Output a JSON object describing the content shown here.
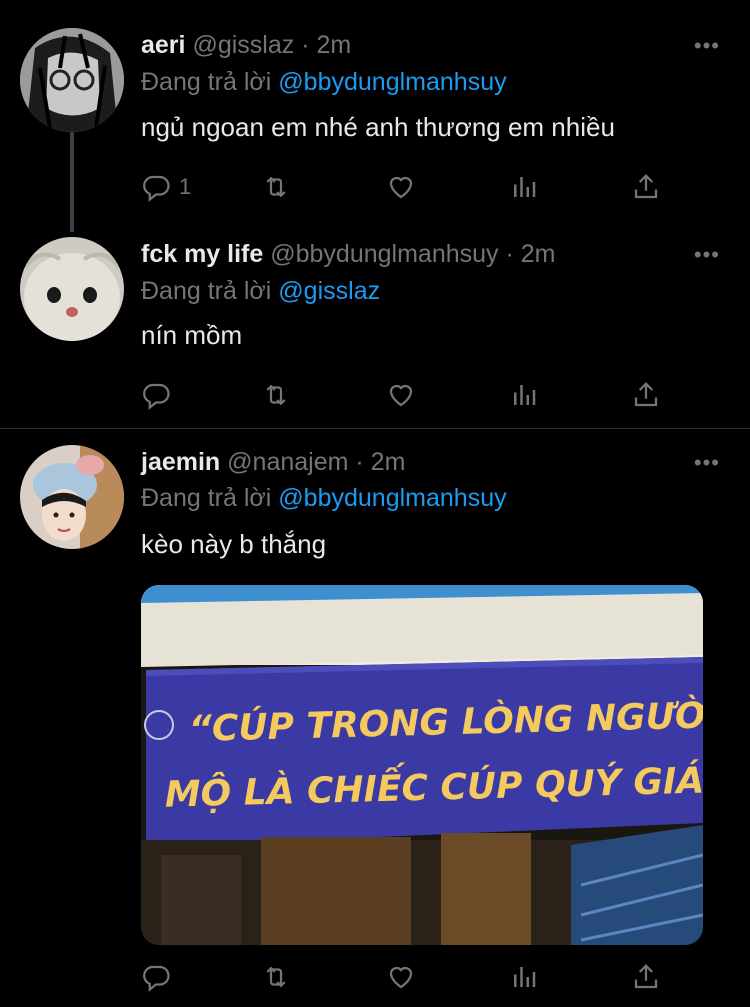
{
  "tweets": [
    {
      "name": "aeri",
      "handle": "@gisslaz",
      "dot": "·",
      "time": "2m",
      "reply_prefix": "Đang trả lời",
      "reply_to": "@bbydunglmanhsuy",
      "text": "ngủ ngoan em nhé anh thương em nhiều",
      "reply_count": "1",
      "more": "•••"
    },
    {
      "name": "fck my life",
      "handle": "@bbydunglmanhsuy",
      "dot": "·",
      "time": "2m",
      "reply_prefix": "Đang trả lời",
      "reply_to": "@gisslaz",
      "text": "nín mồm",
      "reply_count": "",
      "more": "•••"
    },
    {
      "name": "jaemin",
      "handle": "@nanajem",
      "dot": "·",
      "time": "2m",
      "reply_prefix": "Đang trả lời",
      "reply_to": "@bbydunglmanhsuy",
      "text": "kèo này b thắng",
      "reply_count": "",
      "more": "•••",
      "media": {
        "banner_line1": "“CÚP TRONG LÒNG NGƯỜI HÂM",
        "banner_line2": "MỘ LÀ CHIẾC CÚP QUÝ GIÁ NHẤT”"
      }
    }
  ],
  "icons": [
    "reply-icon",
    "retweet-icon",
    "like-icon",
    "analytics-icon",
    "share-icon",
    "more-icon"
  ],
  "colors": {
    "background": "#000000",
    "text": "#e7e9ea",
    "muted": "#71767b",
    "mention": "#1d9bf0",
    "banner": "#3f3fa8"
  }
}
